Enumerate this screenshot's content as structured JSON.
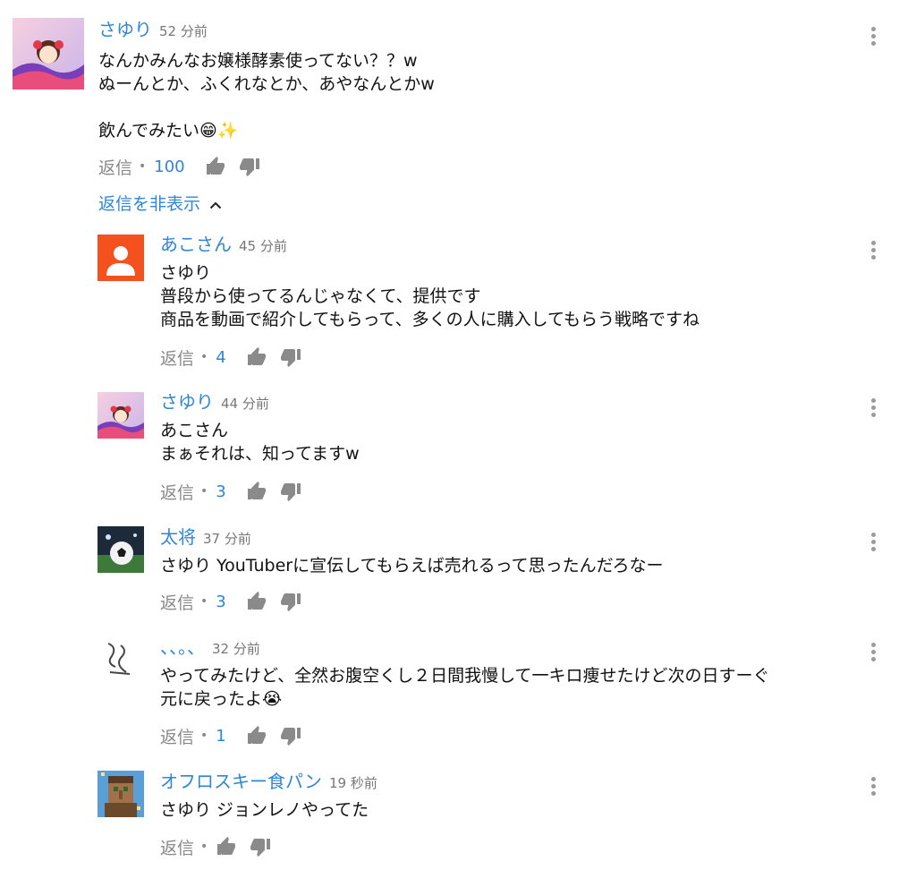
{
  "colors": {
    "link": "#2f86d8",
    "meta": "#888888",
    "text": "#111111"
  },
  "top_comment": {
    "author": "さゆり",
    "time": "52 分前",
    "text": "なんかみんなお嬢様酵素使ってない？？w\nぬーんとか、ふくれなとか、あやなんとかw\n\n飲んでみたい😁✨",
    "reply_label": "返信",
    "likes": "100",
    "avatar_icon": "anime-girl-avatar"
  },
  "toggle_replies": {
    "label": "返信を非表示",
    "icon": "chevron-up-icon"
  },
  "replies": [
    {
      "author": "あこさん",
      "time": "45 分前",
      "text": "さゆり\n普段から使ってるんじゃなくて、提供です\n商品を動画で紹介してもらって、多くの人に購入してもらう戦略ですね",
      "reply_label": "返信",
      "likes": "4",
      "avatar_icon": "default-person-avatar"
    },
    {
      "author": "さゆり",
      "time": "44 分前",
      "text": "あこさん\nまぁそれは、知ってますw",
      "reply_label": "返信",
      "likes": "3",
      "avatar_icon": "anime-girl-avatar"
    },
    {
      "author": "太将",
      "time": "37 分前",
      "text": "さゆり YouTuberに宣伝してもらえば売れるって思ったんだろなー",
      "reply_label": "返信",
      "likes": "3",
      "avatar_icon": "soccer-ball-avatar"
    },
    {
      "author": "、、。、",
      "time": "32 分前",
      "text": "やってみたけど、全然お腹空くし２日間我慢して一キロ痩せたけど次の日すーぐ\n元に戻ったよ😭",
      "reply_label": "返信",
      "likes": "1",
      "avatar_icon": "handwriting-avatar"
    },
    {
      "author": "オフロスキー食パン",
      "time": "19 秒前",
      "text": "さゆり ジョンレノやってた",
      "reply_label": "返信",
      "likes": "",
      "avatar_icon": "pixel-villager-avatar"
    }
  ]
}
